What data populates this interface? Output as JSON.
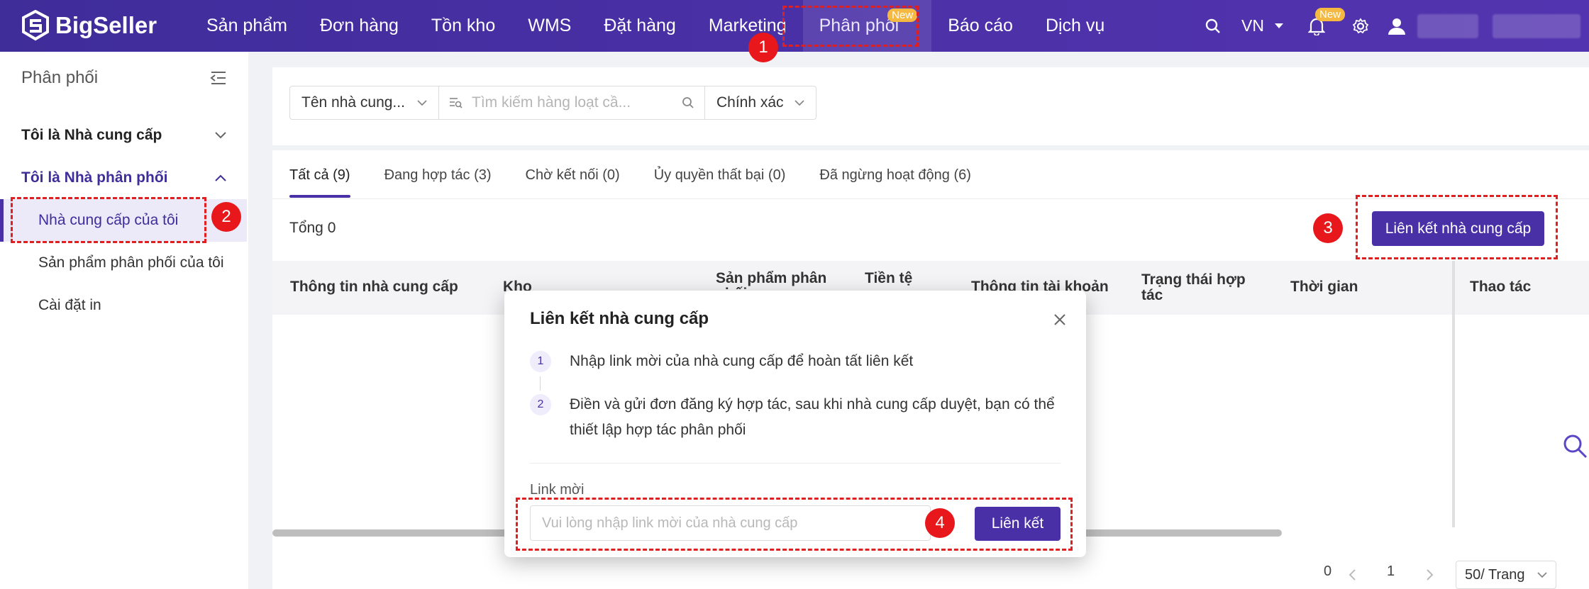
{
  "app": {
    "brand": "BigSeller",
    "brand_color": "#4a30a6"
  },
  "nav": {
    "items": [
      {
        "label": "Sản phẩm"
      },
      {
        "label": "Đơn hàng"
      },
      {
        "label": "Tồn kho"
      },
      {
        "label": "WMS"
      },
      {
        "label": "Đặt hàng"
      },
      {
        "label": "Marketing"
      },
      {
        "label": "Phân phối",
        "badge": "New"
      },
      {
        "label": "Báo cáo"
      },
      {
        "label": "Dịch vụ"
      }
    ],
    "lang": "VN",
    "bell_badge": "New"
  },
  "sidebar": {
    "title": "Phân phối",
    "group1": "Tôi là Nhà cung cấp",
    "group2": "Tôi là Nhà phân phối",
    "items": [
      {
        "label": "Nhà cung cấp của tôi"
      },
      {
        "label": "Sản phẩm phân phối của tôi"
      },
      {
        "label": "Cài đặt in"
      }
    ]
  },
  "filters": {
    "supplier_select": "Tên nhà cung...",
    "search_placeholder": "Tìm kiếm hàng loạt cầ...",
    "match_select": "Chính xác"
  },
  "tabs": [
    {
      "label": "Tất cả (9)"
    },
    {
      "label": "Đang hợp tác (3)"
    },
    {
      "label": "Chờ kết nối (0)"
    },
    {
      "label": "Ủy quyền thất bại (0)"
    },
    {
      "label": "Đã ngừng hoạt động (6)"
    }
  ],
  "total_label": "Tổng 0",
  "link_supplier_button": "Liên kết nhà cung cấp",
  "table": {
    "columns": [
      "Thông tin nhà cung cấp",
      "Kho",
      "Sản phẩm phân phối",
      "Tiền tệ",
      "Thông tin tài khoản",
      "Trạng thái hợp tác",
      "Thời gian",
      "Thao tác"
    ]
  },
  "pager": {
    "total": "0",
    "page": "1",
    "page_size": "50/ Trang"
  },
  "modal": {
    "title": "Liên kết nhà cung cấp",
    "step1_num": "1",
    "step1_text": "Nhập link mời của nhà cung cấp để hoàn tất liên kết",
    "step2_num": "2",
    "step2_text": "Điền và gửi đơn đăng ký hợp tác, sau khi nhà cung cấp duyệt, bạn có thể thiết lập hợp tác phân phối",
    "link_label": "Link mời",
    "link_placeholder": "Vui lòng nhập link mời của nhà cung cấp",
    "submit": "Liên kết"
  },
  "annotations": {
    "m1": "1",
    "m2": "2",
    "m3": "3",
    "m4": "4"
  }
}
